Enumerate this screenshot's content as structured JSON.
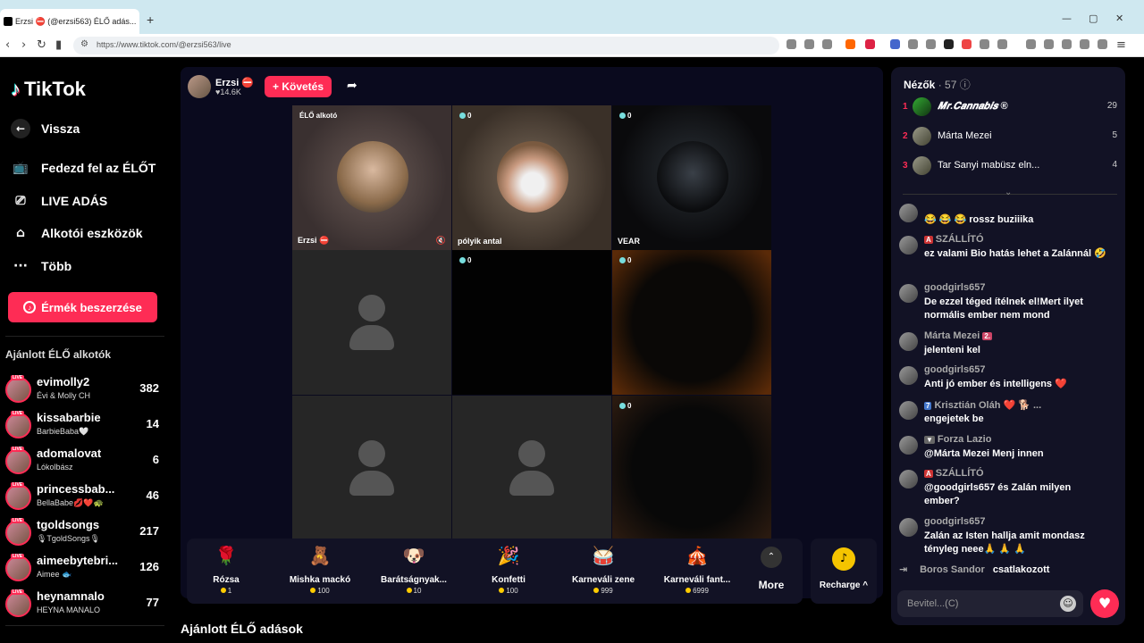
{
  "browser": {
    "tab_title": "Erzsi ⛔ (@erzsi563) ÉLŐ adás...",
    "url": "https://www.tiktok.com/@erzsi563/live",
    "new_tab": "+",
    "minimize": "—",
    "maximize": "▢",
    "close": "✕"
  },
  "sidebar": {
    "logo": "TikTok",
    "back": "Vissza",
    "nav": [
      "Fedezd fel az ÉLŐT",
      "LIVE ADÁS",
      "Alkotói eszközök",
      "Több"
    ],
    "coin_button": "Érmék beszerzése",
    "recommended_title": "Ajánlott ÉLŐ alkotók",
    "recommended": [
      {
        "name": "evimolly2",
        "sub": "Évi & Molly CH",
        "count": "382"
      },
      {
        "name": "kissabarbie",
        "sub": "BarbieBaba🤍",
        "count": "14"
      },
      {
        "name": "adomalovat",
        "sub": "Lókolbász",
        "count": "6"
      },
      {
        "name": "princessbab...",
        "sub": "BellaBabe💋❤️🐢",
        "count": "46"
      },
      {
        "name": "tgoldsongs",
        "sub": "🎙TgoldSongs🎙",
        "count": "217"
      },
      {
        "name": "aimeebytebri...",
        "sub": "Aimee 🐟",
        "count": "126"
      },
      {
        "name": "heynamnalo",
        "sub": "HEYNA MANALO",
        "count": "77"
      }
    ],
    "live_badge": "LIVE"
  },
  "stream": {
    "host_name": "Erzsi ⛔",
    "host_likes": "♥14.6K",
    "follow": "+ Követés",
    "cells": [
      {
        "top_label": "ÉLŐ alkotó",
        "bottom_label": "Erzsi ⛔"
      },
      {
        "top_label": "0",
        "bottom_label": "pólyik antal"
      },
      {
        "top_label": "0",
        "bottom_label": "VEAR"
      },
      {
        "top_label": "",
        "bottom_label": ""
      },
      {
        "top_label": "0",
        "bottom_label": ""
      },
      {
        "top_label": "0",
        "bottom_label": ""
      },
      {
        "top_label": "",
        "bottom_label": ""
      },
      {
        "top_label": "",
        "bottom_label": ""
      },
      {
        "top_label": "0",
        "bottom_label": ""
      }
    ]
  },
  "gifts": [
    {
      "name": "Rózsa",
      "price": "1",
      "icon": "🌹"
    },
    {
      "name": "Mishka mackó",
      "price": "100",
      "icon": "🧸"
    },
    {
      "name": "Barátságnyak...",
      "price": "10",
      "icon": "🐶"
    },
    {
      "name": "Konfetti",
      "price": "100",
      "icon": "🎉"
    },
    {
      "name": "Karneváli zene",
      "price": "999",
      "icon": "🥁"
    },
    {
      "name": "Karneváli fant...",
      "price": "6999",
      "icon": "🎪"
    }
  ],
  "more": "More",
  "recharge": "Recharge ^",
  "bottom_title": "Ajánlott ÉLŐ adások",
  "viewers": {
    "title": "Nézők",
    "count": "· 57",
    "top": [
      {
        "rank": "1",
        "name": "𝑴𝒓.𝑪𝒂𝒏𝒏𝒂𝒃𝒊𝒔 ®",
        "score": "29"
      },
      {
        "rank": "2",
        "name": "Márta Mezei",
        "score": "5"
      },
      {
        "rank": "3",
        "name": "Tar Sanyi mabüsz eln...",
        "score": "4"
      }
    ]
  },
  "chat": [
    {
      "user": "",
      "badge": "",
      "text": "😂 😂 😂 rossz buziiika"
    },
    {
      "user": "SZÁLLÍTÓ",
      "badge": "A",
      "text": "ez valami Bio hatás lehet a Zalánnál 🤣"
    },
    {
      "user": "goodgirls657",
      "badge": "",
      "text": "De ezzel téged ítélnek el!Mert ilyet normális ember nem mond"
    },
    {
      "user": "Márta Mezei",
      "badge": "2.",
      "text": "jelenteni kel"
    },
    {
      "user": "goodgirls657",
      "badge": "",
      "text": "Anti jó ember és intelligens ❤️"
    },
    {
      "user": "Krisztián Oláh ❤️ 🐕 ...",
      "badge": "7",
      "text": "engejetek be"
    },
    {
      "user": "Forza Lazio",
      "badge": "",
      "text": "@Márta Mezei Menj innen"
    },
    {
      "user": "SZÁLLÍTÓ",
      "badge": "A",
      "text": "@goodgirls657 és Zalán milyen ember?"
    },
    {
      "user": "goodgirls657",
      "badge": "",
      "text": "Zalán az Isten hallja amit mondasz tényleg neee🙏 🙏 🙏"
    }
  ],
  "joined": {
    "user": "Boros Sandor",
    "text": "csatlakozott"
  },
  "input_placeholder": "Bevitel...(C)"
}
